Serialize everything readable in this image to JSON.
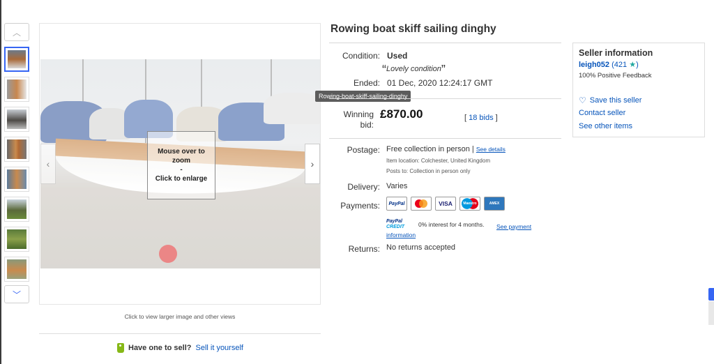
{
  "listing": {
    "title": "Rowing boat skiff sailing dinghy",
    "image_tooltip": "Rowing-boat-skiff-sailing-dinghy",
    "zoom_line1": "Mouse over to zoom",
    "zoom_line2": "-",
    "zoom_line3": "Click to enlarge",
    "click_to_view": "Click to view larger image and other views"
  },
  "details": {
    "condition_label": "Condition:",
    "condition_value": "Used",
    "condition_quote": "Lovely condition",
    "ended_label": "Ended:",
    "ended_value": "01 Dec, 2020  12:24:17 GMT",
    "winning_bid_label_1": "Winning",
    "winning_bid_label_2": "bid:",
    "winning_bid_value": "£870.00",
    "bids_open": "[",
    "bids_count": "18 bids",
    "bids_close": "]",
    "postage_label": "Postage:",
    "postage_value": "Free collection in person",
    "postage_sep": "|",
    "see_details": "See details",
    "item_location_label": "Item location:",
    "item_location_value": "Colchester, United Kingdom",
    "posts_to_label": "Posts to:",
    "posts_to_value": "Collection in person only",
    "delivery_label": "Delivery:",
    "delivery_value": "Varies",
    "payments_label": "Payments:",
    "payment_logos": [
      "PayPal",
      "Mastercard",
      "VISA",
      "Maestro",
      "AMEX"
    ],
    "paypal_credit_logo_1": "PayPal",
    "paypal_credit_logo_2": "CREDIT",
    "credit_text": "0% interest for 4 months.",
    "see_payment_1": "See payment",
    "see_payment_2": "information",
    "returns_label": "Returns:",
    "returns_value": "No returns accepted"
  },
  "seller": {
    "header": "Seller information",
    "username": "leigh052",
    "feedback_score": "(421",
    "feedback_close": ")",
    "positive_feedback": "100% Positive Feedback",
    "save_seller": "Save this seller",
    "contact_seller": "Contact seller",
    "see_other_items": "See other items"
  },
  "sell": {
    "question": "Have one to sell?",
    "link": "Sell it yourself"
  },
  "icons": {
    "up": "chevron-up-icon",
    "down": "chevron-down-icon",
    "left": "chevron-left-icon",
    "right": "chevron-right-icon",
    "heart": "heart-icon",
    "star": "star-icon",
    "tag": "price-tag-icon"
  },
  "colors": {
    "link": "#0654ba",
    "active_thumb_border": "#3665f3",
    "feedback_star": "#20a8a0",
    "sell_tag": "#86b817"
  }
}
